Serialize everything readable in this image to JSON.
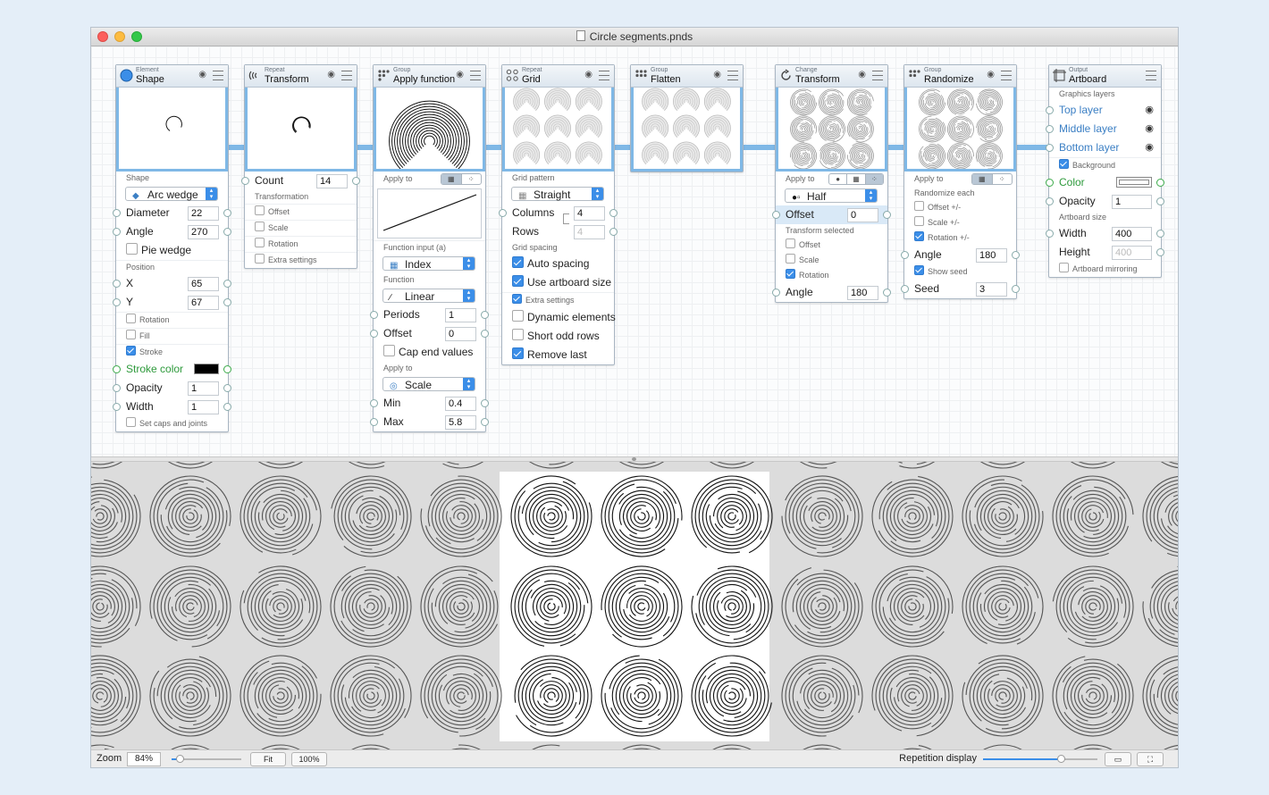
{
  "window": {
    "title": "Circle segments.pnds"
  },
  "nodes": {
    "shape": {
      "category": "Element",
      "title": "Shape",
      "shape_label": "Shape",
      "shape_value": "Arc wedge",
      "diameter_label": "Diameter",
      "diameter_value": "22",
      "angle_label": "Angle",
      "angle_value": "270",
      "pie_label": "Pie wedge",
      "position_label": "Position",
      "x_label": "X",
      "x_value": "65",
      "y_label": "Y",
      "y_value": "67",
      "rotation_label": "Rotation",
      "fill_label": "Fill",
      "stroke_label": "Stroke",
      "stroke_color_label": "Stroke color",
      "opacity_label": "Opacity",
      "opacity_value": "1",
      "width_label": "Width",
      "width_value": "1",
      "caps_label": "Set caps and joints"
    },
    "repeat_transform": {
      "category": "Repeat",
      "title": "Transform",
      "count_label": "Count",
      "count_value": "14",
      "transformation_label": "Transformation",
      "offset_label": "Offset",
      "scale_label": "Scale",
      "rotation_label": "Rotation",
      "extra_label": "Extra settings"
    },
    "apply_function": {
      "category": "Group",
      "title": "Apply function",
      "apply_to_label": "Apply to",
      "function_input_label": "Function input (a)",
      "function_input_value": "Index",
      "function_label": "Function",
      "function_value": "Linear",
      "periods_label": "Periods",
      "periods_value": "1",
      "offset_label": "Offset",
      "offset_value": "0",
      "cap_label": "Cap end values",
      "apply_to2_label": "Apply to",
      "apply_to2_value": "Scale",
      "min_label": "Min",
      "min_value": "0.4",
      "max_label": "Max",
      "max_value": "5.8"
    },
    "grid": {
      "category": "Repeat",
      "title": "Grid",
      "pattern_label": "Grid pattern",
      "pattern_value": "Straight",
      "columns_label": "Columns",
      "columns_value": "4",
      "rows_label": "Rows",
      "rows_value": "4",
      "spacing_label": "Grid spacing",
      "auto_spacing_label": "Auto spacing",
      "artboard_size_label": "Use artboard size",
      "extra_label": "Extra settings",
      "dynamic_label": "Dynamic elements",
      "short_odd_label": "Short odd rows",
      "remove_last_label": "Remove last"
    },
    "flatten": {
      "category": "Group",
      "title": "Flatten"
    },
    "change_transform": {
      "category": "Change",
      "title": "Transform",
      "apply_to_label": "Apply to",
      "mode_value": "Half",
      "offset_label": "Offset",
      "offset_value": "0",
      "transform_selected_label": "Transform selected",
      "t_offset_label": "Offset",
      "t_scale_label": "Scale",
      "t_rotation_label": "Rotation",
      "angle_label": "Angle",
      "angle_value": "180"
    },
    "randomize": {
      "category": "Group",
      "title": "Randomize",
      "apply_to_label": "Apply to",
      "randomize_each_label": "Randomize each",
      "offset_label": "Offset +/-",
      "scale_label": "Scale +/-",
      "rotation_label": "Rotation +/-",
      "angle_label": "Angle",
      "angle_value": "180",
      "show_seed_label": "Show seed",
      "seed_label": "Seed",
      "seed_value": "3"
    },
    "artboard": {
      "category": "Output",
      "title": "Artboard",
      "layers_label": "Graphics layers",
      "top_layer": "Top layer",
      "middle_layer": "Middle layer",
      "bottom_layer": "Bottom layer",
      "background_label": "Background",
      "color_label": "Color",
      "opacity_label": "Opacity",
      "opacity_value": "1",
      "size_label": "Artboard size",
      "width_label": "Width",
      "width_value": "400",
      "height_label": "Height",
      "height_value": "400",
      "mirroring_label": "Artboard mirroring"
    }
  },
  "statusbar": {
    "zoom_label": "Zoom",
    "zoom_value": "84%",
    "fit_label": "Fit",
    "full_label": "100%",
    "repetition_label": "Repetition display",
    "zoom_fraction": 0.12,
    "repetition_fraction": 0.68
  },
  "colors": {
    "accent": "#3b8ee8",
    "connection": "#7fb8e6",
    "layer_text": "#3b7fc4",
    "preview_bg": "#dcdcdc"
  },
  "icons": [
    "eye-icon",
    "menu-icon",
    "shape-icon",
    "repeat-icon",
    "group-icon",
    "grid-icon",
    "change-icon",
    "output-icon",
    "view-icon",
    "fullscreen-icon"
  ]
}
